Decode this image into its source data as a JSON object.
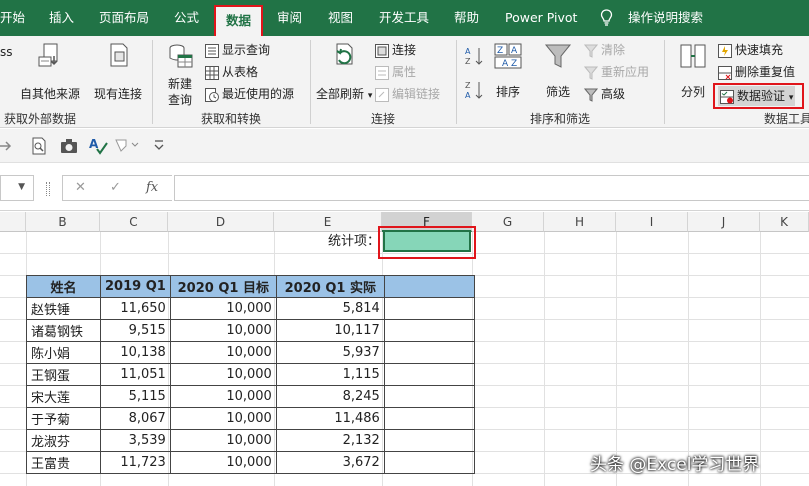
{
  "tabs": [
    "开始",
    "插入",
    "页面布局",
    "公式",
    "数据",
    "审阅",
    "视图",
    "开发工具",
    "帮助",
    "Power Pivot",
    "操作说明搜索"
  ],
  "ribbon": {
    "get_external": {
      "partial": "ss",
      "other_sources": "自其他来源",
      "existing": "现有连接",
      "label": "获取外部数据"
    },
    "get_transform": {
      "new_query": "新建\n查询",
      "show_queries": "显示查询",
      "from_table": "从表格",
      "recent_sources": "最近使用的源",
      "label": "获取和转换"
    },
    "connections": {
      "refresh_all": "全部刷新",
      "connections": "连接",
      "properties": "属性",
      "edit_links": "编辑链接",
      "label": "连接"
    },
    "sort_filter": {
      "sort": "排序",
      "filter": "筛选",
      "clear": "清除",
      "reapply": "重新应用",
      "advanced": "高级",
      "label": "排序和筛选"
    },
    "data_tools": {
      "split": "分列",
      "flash_fill": "快速填充",
      "remove_dup": "删除重复值",
      "validation": "数据验证",
      "label": "数据工具"
    }
  },
  "formula_bar": {
    "fx": "fx",
    "cancel": "✕",
    "enter": "✓"
  },
  "columns": [
    "B",
    "C",
    "D",
    "E",
    "F",
    "G",
    "H",
    "I",
    "J",
    "K"
  ],
  "stat_label": "统计项：",
  "table": {
    "headers": [
      "姓名",
      "2019 Q1",
      "2020 Q1 目标",
      "2020 Q1 实际"
    ],
    "rows": [
      [
        "赵铁锤",
        "11,650",
        "10,000",
        "5,814"
      ],
      [
        "诸葛钢铁",
        "9,515",
        "10,000",
        "10,117"
      ],
      [
        "陈小娟",
        "10,138",
        "10,000",
        "5,937"
      ],
      [
        "王钢蛋",
        "11,051",
        "10,000",
        "1,115"
      ],
      [
        "宋大莲",
        "5,115",
        "10,000",
        "8,245"
      ],
      [
        "于予菊",
        "8,067",
        "10,000",
        "11,486"
      ],
      [
        "龙淑芬",
        "3,539",
        "10,000",
        "2,132"
      ],
      [
        "王富贵",
        "11,723",
        "10,000",
        "3,672"
      ]
    ]
  },
  "watermark": "头条 @Excel学习世界",
  "colors": {
    "excel_green": "#217346",
    "highlight_red": "#e0151b",
    "header_blue": "#9bc2e6",
    "cell_teal": "#86d6b8"
  }
}
